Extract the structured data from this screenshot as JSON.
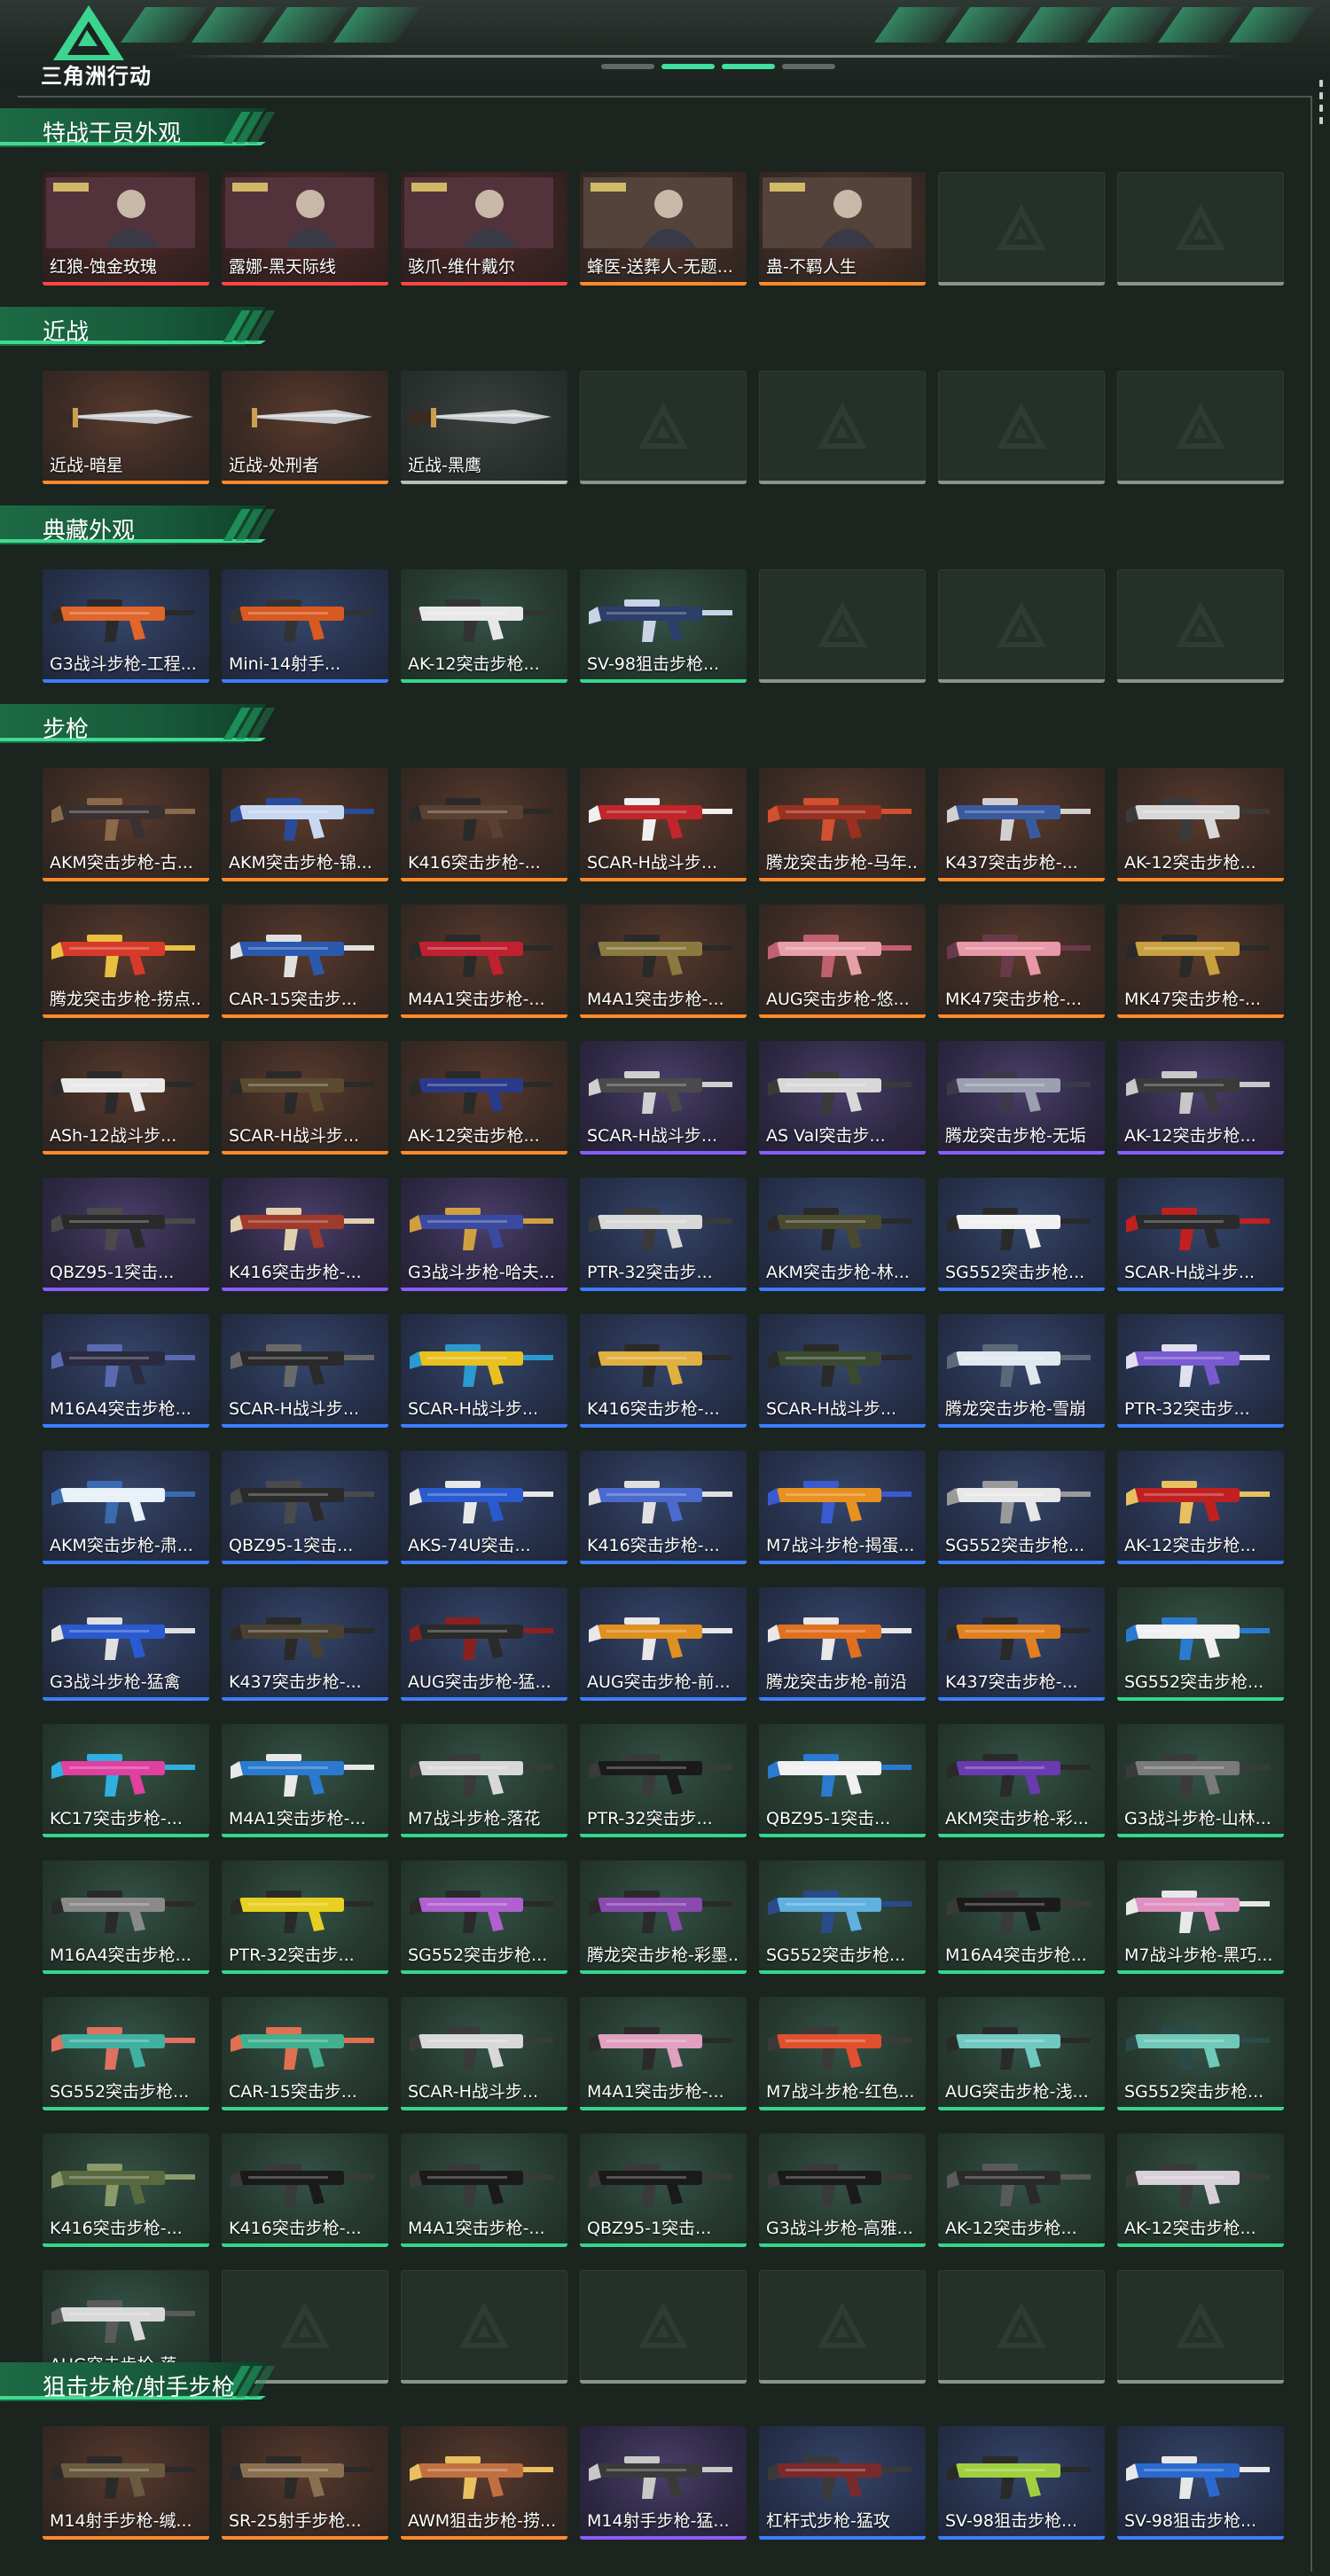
{
  "header": {
    "title": "三角洲行动"
  },
  "colors": {
    "orange": "#ff8a2a",
    "purple": "#8a5cff",
    "blue": "#3c7dff",
    "green": "#34d78a",
    "red": "#ff4646",
    "gray": "#b8bfbb",
    "accent": "#3ddc90"
  },
  "sections": [
    {
      "title": "特战干员外观",
      "items": [
        {
          "label": "红狼-蚀金玫瑰",
          "tier": "red",
          "kind": "operator"
        },
        {
          "label": "露娜-黑天际线",
          "tier": "red",
          "kind": "operator"
        },
        {
          "label": "骇爪-维什戴尔",
          "tier": "red",
          "kind": "operator"
        },
        {
          "label": "蜂医-送葬人-无题...",
          "tier": "orange",
          "kind": "operator"
        },
        {
          "label": "蛊-不羁人生",
          "tier": "orange",
          "kind": "operator"
        },
        {
          "label": "",
          "tier": "empty",
          "kind": "empty"
        },
        {
          "label": "",
          "tier": "empty",
          "kind": "empty"
        }
      ]
    },
    {
      "title": "近战",
      "items": [
        {
          "label": "近战-暗星",
          "tier": "orange",
          "kind": "knife"
        },
        {
          "label": "近战-处刑者",
          "tier": "orange",
          "kind": "knife"
        },
        {
          "label": "近战-黑鹰",
          "tier": "gray",
          "kind": "knife"
        },
        {
          "label": "",
          "tier": "empty",
          "kind": "empty"
        },
        {
          "label": "",
          "tier": "empty",
          "kind": "empty"
        },
        {
          "label": "",
          "tier": "empty",
          "kind": "empty"
        },
        {
          "label": "",
          "tier": "empty",
          "kind": "empty"
        }
      ]
    },
    {
      "title": "典藏外观",
      "items": [
        {
          "label": "G3战斗步枪-工程...",
          "tier": "blue",
          "kind": "gun",
          "c1": "#e0662a",
          "c2": "#2a2a2a"
        },
        {
          "label": "Mini-14射手...",
          "tier": "blue",
          "kind": "gun",
          "c1": "#d85a20",
          "c2": "#333333"
        },
        {
          "label": "AK-12突击步枪...",
          "tier": "green",
          "kind": "gun",
          "c1": "#e8e8e8",
          "c2": "#333333"
        },
        {
          "label": "SV-98狙击步枪...",
          "tier": "green",
          "kind": "gun",
          "c1": "#2c3e6a",
          "c2": "#c9d3e6"
        },
        {
          "label": "",
          "tier": "empty",
          "kind": "empty"
        },
        {
          "label": "",
          "tier": "empty",
          "kind": "empty"
        },
        {
          "label": "",
          "tier": "empty",
          "kind": "empty"
        }
      ]
    },
    {
      "title": "步枪",
      "items": [
        {
          "label": "AKM突击步枪-古...",
          "tier": "orange",
          "kind": "gun",
          "c1": "#3a3030",
          "c2": "#8a6a4a"
        },
        {
          "label": "AKM突击步枪-锦...",
          "tier": "orange",
          "kind": "gun",
          "c1": "#c8d8f0",
          "c2": "#2a4a9a"
        },
        {
          "label": "K416突击步枪-...",
          "tier": "orange",
          "kind": "gun",
          "c1": "#5a4030",
          "c2": "#2a2a2a"
        },
        {
          "label": "SCAR-H战斗步...",
          "tier": "orange",
          "kind": "gun",
          "c1": "#c0262a",
          "c2": "#f0f0f0"
        },
        {
          "label": "腾龙突击步枪-马年...",
          "tier": "orange",
          "kind": "gun",
          "c1": "#9a3020",
          "c2": "#d05030"
        },
        {
          "label": "K437突击步枪-...",
          "tier": "orange",
          "kind": "gun",
          "c1": "#3a5aa0",
          "c2": "#d0d0d0"
        },
        {
          "label": "AK-12突击步枪...",
          "tier": "orange",
          "kind": "gun",
          "c1": "#d8d8d8",
          "c2": "#3a3a3a"
        },
        {
          "label": "腾龙突击步枪-捞点...",
          "tier": "orange",
          "kind": "gun",
          "c1": "#d83a2a",
          "c2": "#e8c040"
        },
        {
          "label": "CAR-15突击步...",
          "tier": "orange",
          "kind": "gun",
          "c1": "#2a5ab0",
          "c2": "#e0e0e0"
        },
        {
          "label": "M4A1突击步枪-...",
          "tier": "orange",
          "kind": "gun",
          "c1": "#c02030",
          "c2": "#2a2a2a"
        },
        {
          "label": "M4A1突击步枪-...",
          "tier": "orange",
          "kind": "gun",
          "c1": "#8a7a40",
          "c2": "#2a2a2a"
        },
        {
          "label": "AUG突击步枪-悠...",
          "tier": "orange",
          "kind": "gun",
          "c1": "#e8a0a8",
          "c2": "#c06070"
        },
        {
          "label": "MK47突击步枪-...",
          "tier": "orange",
          "kind": "gun",
          "c1": "#e898a8",
          "c2": "#6a3a4a"
        },
        {
          "label": "MK47突击步枪-...",
          "tier": "orange",
          "kind": "gun",
          "c1": "#c8a040",
          "c2": "#2a2a2a"
        },
        {
          "label": "ASh-12战斗步...",
          "tier": "orange",
          "kind": "gun",
          "c1": "#e8e8e8",
          "c2": "#2a2a2a"
        },
        {
          "label": "SCAR-H战斗步...",
          "tier": "orange",
          "kind": "gun",
          "c1": "#5a4a30",
          "c2": "#2a2a2a"
        },
        {
          "label": "AK-12突击步枪...",
          "tier": "orange",
          "kind": "gun",
          "c1": "#2a3a8a",
          "c2": "#2a2a2a"
        },
        {
          "label": "SCAR-H战斗步...",
          "tier": "purple",
          "kind": "gun",
          "c1": "#4a4a4a",
          "c2": "#d0d0d0"
        },
        {
          "label": "AS Val突击步...",
          "tier": "purple",
          "kind": "gun",
          "c1": "#d8d8d8",
          "c2": "#3a3a3a"
        },
        {
          "label": "腾龙突击步枪-无垢",
          "tier": "purple",
          "kind": "gun",
          "c1": "#9aa0b0",
          "c2": "#3a3a4a"
        },
        {
          "label": "AK-12突击步枪...",
          "tier": "purple",
          "kind": "gun",
          "c1": "#3a3a3a",
          "c2": "#c8c8c8"
        },
        {
          "label": "QBZ95-1突击...",
          "tier": "purple",
          "kind": "gun",
          "c1": "#2a2a2a",
          "c2": "#4a4a4a"
        },
        {
          "label": "K416突击步枪-...",
          "tier": "purple",
          "kind": "gun",
          "c1": "#a03a2a",
          "c2": "#e0d0b0"
        },
        {
          "label": "G3战斗步枪-哈夫...",
          "tier": "purple",
          "kind": "gun",
          "c1": "#3a4aa0",
          "c2": "#d0a040"
        },
        {
          "label": "PTR-32突击步...",
          "tier": "blue",
          "kind": "gun",
          "c1": "#d8d8d8",
          "c2": "#3a3a3a"
        },
        {
          "label": "AKM突击步枪-林...",
          "tier": "blue",
          "kind": "gun",
          "c1": "#4a4a30",
          "c2": "#2a2a2a"
        },
        {
          "label": "SG552突击步枪...",
          "tier": "blue",
          "kind": "gun",
          "c1": "#f0f0f0",
          "c2": "#2a2a2a"
        },
        {
          "label": "SCAR-H战斗步...",
          "tier": "blue",
          "kind": "gun",
          "c1": "#2a2a2a",
          "c2": "#c02020"
        },
        {
          "label": "M16A4突击步枪...",
          "tier": "blue",
          "kind": "gun",
          "c1": "#2a2a40",
          "c2": "#5a6ab0"
        },
        {
          "label": "SCAR-H战斗步...",
          "tier": "blue",
          "kind": "gun",
          "c1": "#2a2a2a",
          "c2": "#6a6a6a"
        },
        {
          "label": "SCAR-H战斗步...",
          "tier": "blue",
          "kind": "gun",
          "c1": "#e8c020",
          "c2": "#2a9ad0"
        },
        {
          "label": "K416突击步枪-...",
          "tier": "blue",
          "kind": "gun",
          "c1": "#e0b040",
          "c2": "#2a2a2a"
        },
        {
          "label": "SCAR-H战斗步...",
          "tier": "blue",
          "kind": "gun",
          "c1": "#3a4a30",
          "c2": "#2a2a2a"
        },
        {
          "label": "腾龙突击步枪-雪崩",
          "tier": "blue",
          "kind": "gun",
          "c1": "#e0e8f0",
          "c2": "#5a6a7a"
        },
        {
          "label": "PTR-32突击步...",
          "tier": "blue",
          "kind": "gun",
          "c1": "#7a5ad0",
          "c2": "#e0e0f0"
        },
        {
          "label": "AKM突击步枪-肃...",
          "tier": "blue",
          "kind": "gun",
          "c1": "#e8f0f8",
          "c2": "#3a6ab0"
        },
        {
          "label": "QBZ95-1突击...",
          "tier": "blue",
          "kind": "gun",
          "c1": "#2a2a2a",
          "c2": "#4a4a4a"
        },
        {
          "label": "AKS-74U突击...",
          "tier": "blue",
          "kind": "gun",
          "c1": "#2a5ad0",
          "c2": "#e8e8e8"
        },
        {
          "label": "K416突击步枪-...",
          "tier": "blue",
          "kind": "gun",
          "c1": "#4a6ad0",
          "c2": "#e0e0e0"
        },
        {
          "label": "M7战斗步枪-揭蛋...",
          "tier": "blue",
          "kind": "gun",
          "c1": "#e89020",
          "c2": "#3a5ad0"
        },
        {
          "label": "SG552突击步枪...",
          "tier": "blue",
          "kind": "gun",
          "c1": "#e8e8e8",
          "c2": "#9a9a9a"
        },
        {
          "label": "AK-12突击步枪...",
          "tier": "blue",
          "kind": "gun",
          "c1": "#c02020",
          "c2": "#e8c060"
        },
        {
          "label": "G3战斗步枪-猛禽",
          "tier": "blue",
          "kind": "gun",
          "c1": "#2a5ad0",
          "c2": "#e0e0e0"
        },
        {
          "label": "K437突击步枪-...",
          "tier": "blue",
          "kind": "gun",
          "c1": "#4a4030",
          "c2": "#2a2a2a"
        },
        {
          "label": "AUG突击步枪-猛...",
          "tier": "blue",
          "kind": "gun",
          "c1": "#2a2a2a",
          "c2": "#8a2020"
        },
        {
          "label": "AUG突击步枪-前...",
          "tier": "blue",
          "kind": "gun",
          "c1": "#e09020",
          "c2": "#e8e8e8"
        },
        {
          "label": "腾龙突击步枪-前沿",
          "tier": "blue",
          "kind": "gun",
          "c1": "#e07020",
          "c2": "#e8e8e8"
        },
        {
          "label": "K437突击步枪-...",
          "tier": "blue",
          "kind": "gun",
          "c1": "#e08020",
          "c2": "#2a2a2a"
        },
        {
          "label": "SG552突击步枪...",
          "tier": "green",
          "kind": "gun",
          "c1": "#f0f0f0",
          "c2": "#2a7ad0"
        },
        {
          "label": "KC17突击步枪-...",
          "tier": "green",
          "kind": "gun",
          "c1": "#e040a0",
          "c2": "#30b0e0"
        },
        {
          "label": "M4A1突击步枪-...",
          "tier": "green",
          "kind": "gun",
          "c1": "#2a7ad0",
          "c2": "#e8e8e8"
        },
        {
          "label": "M7战斗步枪-落花",
          "tier": "green",
          "kind": "gun",
          "c1": "#d8d8d8",
          "c2": "#3a3a3a"
        },
        {
          "label": "PTR-32突击步...",
          "tier": "green",
          "kind": "gun",
          "c1": "#1a1a1a",
          "c2": "#3a3a3a"
        },
        {
          "label": "QBZ95-1突击...",
          "tier": "green",
          "kind": "gun",
          "c1": "#f0f0f0",
          "c2": "#2a7ad0"
        },
        {
          "label": "AKM突击步枪-彩...",
          "tier": "green",
          "kind": "gun",
          "c1": "#6a3ab0",
          "c2": "#2a2a2a"
        },
        {
          "label": "G3战斗步枪-山林...",
          "tier": "green",
          "kind": "gun",
          "c1": "#7a7a7a",
          "c2": "#3a3a3a"
        },
        {
          "label": "M16A4突击步枪...",
          "tier": "green",
          "kind": "gun",
          "c1": "#8a8a8a",
          "c2": "#2a2a2a"
        },
        {
          "label": "PTR-32突击步...",
          "tier": "green",
          "kind": "gun",
          "c1": "#e8d020",
          "c2": "#2a2a2a"
        },
        {
          "label": "SG552突击步枪...",
          "tier": "green",
          "kind": "gun",
          "c1": "#b060d0",
          "c2": "#2a2a2a"
        },
        {
          "label": "腾龙突击步枪-彩墨...",
          "tier": "green",
          "kind": "gun",
          "c1": "#8a4ab0",
          "c2": "#2a2a2a"
        },
        {
          "label": "SG552突击步枪...",
          "tier": "green",
          "kind": "gun",
          "c1": "#60b0e0",
          "c2": "#2a4a8a"
        },
        {
          "label": "M16A4突击步枪...",
          "tier": "green",
          "kind": "gun",
          "c1": "#1a1a1a",
          "c2": "#3a3a3a"
        },
        {
          "label": "M7战斗步枪-黑巧...",
          "tier": "green",
          "kind": "gun",
          "c1": "#e090c0",
          "c2": "#e8e8e8"
        },
        {
          "label": "SG552突击步枪...",
          "tier": "green",
          "kind": "gun",
          "c1": "#40b0a0",
          "c2": "#e07060"
        },
        {
          "label": "CAR-15突击步...",
          "tier": "green",
          "kind": "gun",
          "c1": "#40b090",
          "c2": "#e07050"
        },
        {
          "label": "SCAR-H战斗步...",
          "tier": "green",
          "kind": "gun",
          "c1": "#d8d8d8",
          "c2": "#3a3a3a"
        },
        {
          "label": "M4A1突击步枪-...",
          "tier": "green",
          "kind": "gun",
          "c1": "#e0a0c0",
          "c2": "#2a2a2a"
        },
        {
          "label": "M7战斗步枪-红色...",
          "tier": "green",
          "kind": "gun",
          "c1": "#e05030",
          "c2": "#3a3a3a"
        },
        {
          "label": "AUG突击步枪-浅...",
          "tier": "green",
          "kind": "gun",
          "c1": "#70c8c0",
          "c2": "#2a2a2a"
        },
        {
          "label": "SG552突击步枪...",
          "tier": "green",
          "kind": "gun",
          "c1": "#70c8b8",
          "c2": "#2a4a4a"
        },
        {
          "label": "K416突击步枪-...",
          "tier": "green",
          "kind": "gun",
          "c1": "#5a6a40",
          "c2": "#8a9a6a"
        },
        {
          "label": "K416突击步枪-...",
          "tier": "green",
          "kind": "gun",
          "c1": "#1a1a1a",
          "c2": "#3a3a3a"
        },
        {
          "label": "M4A1突击步枪-...",
          "tier": "green",
          "kind": "gun",
          "c1": "#1a1a1a",
          "c2": "#3a3a3a"
        },
        {
          "label": "QBZ95-1突击...",
          "tier": "green",
          "kind": "gun",
          "c1": "#1a1a1a",
          "c2": "#3a3a3a"
        },
        {
          "label": "G3战斗步枪-高雅...",
          "tier": "green",
          "kind": "gun",
          "c1": "#1a1a1a",
          "c2": "#3a3a3a"
        },
        {
          "label": "AK-12突击步枪...",
          "tier": "green",
          "kind": "gun",
          "c1": "#2a2a2a",
          "c2": "#5a5a5a"
        },
        {
          "label": "AK-12突击步枪...",
          "tier": "green",
          "kind": "gun",
          "c1": "#d8d0d8",
          "c2": "#3a3a3a"
        },
        {
          "label": "AUG突击步枪-落...",
          "tier": "green",
          "kind": "gun",
          "c1": "#d8d8d8",
          "c2": "#5a5a5a"
        },
        {
          "label": "",
          "tier": "empty",
          "kind": "empty"
        },
        {
          "label": "",
          "tier": "empty",
          "kind": "empty"
        },
        {
          "label": "",
          "tier": "empty",
          "kind": "empty"
        },
        {
          "label": "",
          "tier": "empty",
          "kind": "empty"
        },
        {
          "label": "",
          "tier": "empty",
          "kind": "empty"
        },
        {
          "label": "",
          "tier": "empty",
          "kind": "empty"
        }
      ]
    },
    {
      "title": "狙击步枪/射手步枪",
      "items": [
        {
          "label": "M14射手步枪-缄...",
          "tier": "orange",
          "kind": "gun",
          "c1": "#6a5a40",
          "c2": "#2a2a2a"
        },
        {
          "label": "SR-25射手步枪...",
          "tier": "orange",
          "kind": "gun",
          "c1": "#8a7050",
          "c2": "#2a2a2a"
        },
        {
          "label": "AWM狙击步枪-捞...",
          "tier": "orange",
          "kind": "gun",
          "c1": "#c07040",
          "c2": "#e8c060"
        },
        {
          "label": "M14射手步枪-猛...",
          "tier": "purple",
          "kind": "gun",
          "c1": "#3a3a3a",
          "c2": "#c8c8c8"
        },
        {
          "label": "杠杆式步枪-猛攻",
          "tier": "blue",
          "kind": "gun",
          "c1": "#7a2a2a",
          "c2": "#3a3a3a"
        },
        {
          "label": "SV-98狙击步枪...",
          "tier": "blue",
          "kind": "gun",
          "c1": "#a0d040",
          "c2": "#2a2a2a"
        },
        {
          "label": "SV-98狙击步枪...",
          "tier": "blue",
          "kind": "gun",
          "c1": "#2a6ad0",
          "c2": "#e8e8e8"
        }
      ]
    }
  ]
}
